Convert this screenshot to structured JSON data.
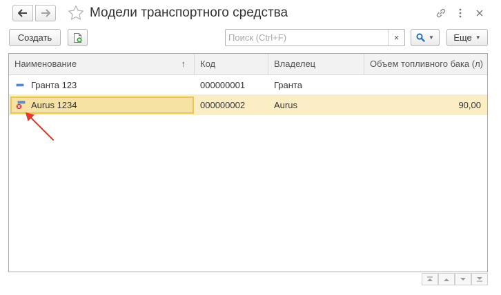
{
  "window": {
    "title": "Модели транспортного средства"
  },
  "toolbar": {
    "create_label": "Создать",
    "search_placeholder": "Поиск (Ctrl+F)",
    "search_clear": "×",
    "more_label": "Еще"
  },
  "table": {
    "columns": [
      {
        "label": "Наименование",
        "sort": "ascending"
      },
      {
        "label": "Код"
      },
      {
        "label": "Владелец"
      },
      {
        "label": "Объем топливного бака (л)"
      }
    ],
    "rows": [
      {
        "name": "Гранта 123",
        "code": "000000001",
        "owner": "Гранта",
        "tank": "",
        "marked_for_deletion": false,
        "selected": false
      },
      {
        "name": "Aurus 1234",
        "code": "000000002",
        "owner": "Aurus",
        "tank": "90,00",
        "marked_for_deletion": true,
        "selected": true
      }
    ]
  },
  "icons": {
    "back": "arrow-left-icon",
    "forward": "arrow-right-icon",
    "favorite": "star-icon",
    "link": "link-icon",
    "more": "more-vertical-icon",
    "close": "close-icon",
    "copy": "copy-document-icon",
    "search": "search-icon",
    "sort": "sort-ascending-icon",
    "row_item": "catalog-item-icon",
    "row_deleted": "deletion-mark-icon"
  },
  "colors": {
    "selected_row": "#fbeec4",
    "selected_cell_border": "#ecc55a",
    "annotation_arrow": "#e03a2f",
    "search_accent": "#2f6fb5"
  }
}
